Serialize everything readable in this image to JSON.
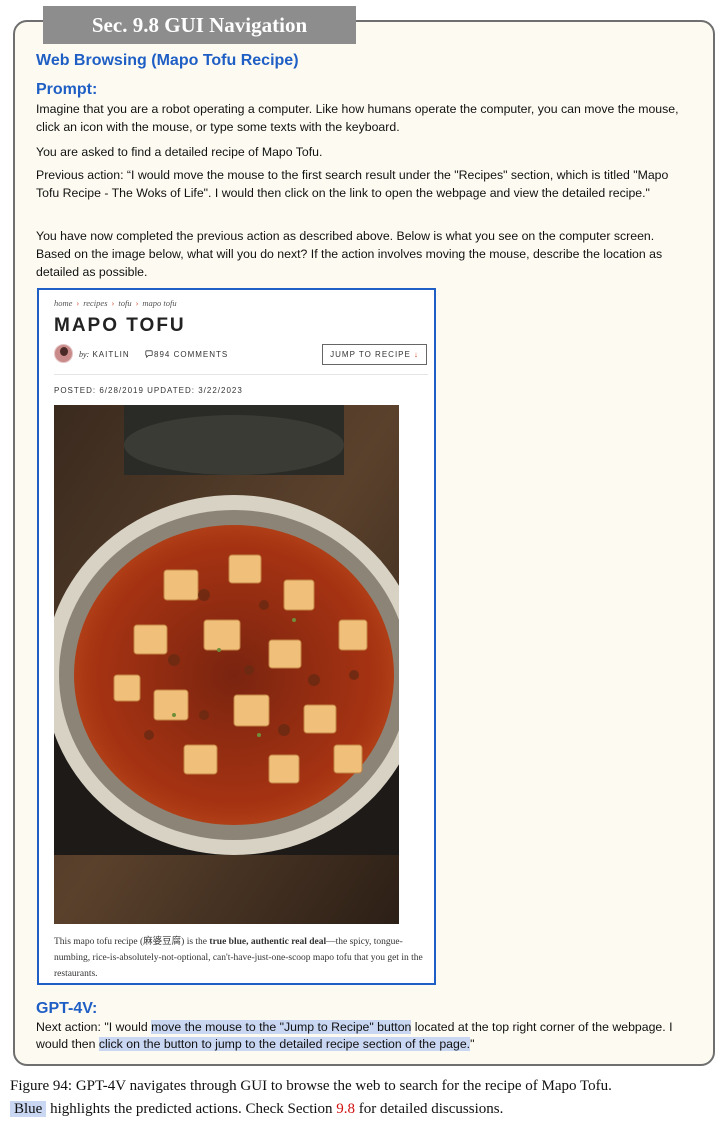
{
  "section_tab": "Sec. 9.8 GUI Navigation",
  "subtitle": "Web Browsing (Mapo Tofu Recipe)",
  "prompt_label": "Prompt:",
  "prompt": {
    "p1": "Imagine that you are a robot operating a computer. Like how humans operate the computer, you can move the mouse, click an icon with the mouse, or type some texts with the keyboard.",
    "p2": "You are asked to find a detailed recipe of Mapo Tofu.",
    "p3": "Previous action: “I would move the mouse to the first search result under the \"Recipes\" section, which is titled \"Mapo Tofu Recipe - The Woks of Life\". I would then click on the link to open the webpage and view the detailed recipe.\"",
    "p4": "You have now completed the previous action as described above. Below is what you see on the computer screen. Based on the image below, what will you do next? If the action involves moving the mouse, describe the location as detailed as possible."
  },
  "webpage": {
    "breadcrumb": [
      "home",
      "recipes",
      "tofu",
      "mapo tofu"
    ],
    "breadcrumb_sep": "›",
    "title": "MAPO TOFU",
    "by_prefix": "by:",
    "author": "KAITLIN",
    "comments": "894 COMMENTS",
    "comment_icon": "speech-bubble",
    "jump_button": "JUMP TO RECIPE",
    "jump_arrow": "↓",
    "posted": "POSTED: 6/28/2019  UPDATED: 3/22/2023",
    "caption_1": "This mapo tofu recipe (麻婆豆腐) is the",
    "caption_bold": "true blue, authentic real deal",
    "caption_2": "—the spicy, tongue-numbing, rice-is-absolutely-not-optional, can't-have-just-one-scoop mapo tofu that you get in the restaurants."
  },
  "gpt_label": "GPT-4V:",
  "answer": {
    "a1": "Next action: \"I would ",
    "a2": "move the mouse to the \"Jump to Recipe\" button",
    "a3": " located at the top right corner of the webpage. I would then ",
    "a4": "click on the button to jump to the detailed recipe section of the page.",
    "a5": "\""
  },
  "figure_caption": {
    "c1": "Figure 94: GPT-4V navigates through GUI to browse the web to search for the recipe of Mapo Tofu.",
    "chip": "Blue",
    "c2": " highlights the predicted actions. Check Section ",
    "ref": "9.8",
    "c3": " for detailed discussions."
  },
  "colors": {
    "accent_blue": "#1f5fc5",
    "highlight": "#c9d7f2",
    "ref_red": "#d10f0f",
    "box_bg": "#fdfbf1"
  }
}
